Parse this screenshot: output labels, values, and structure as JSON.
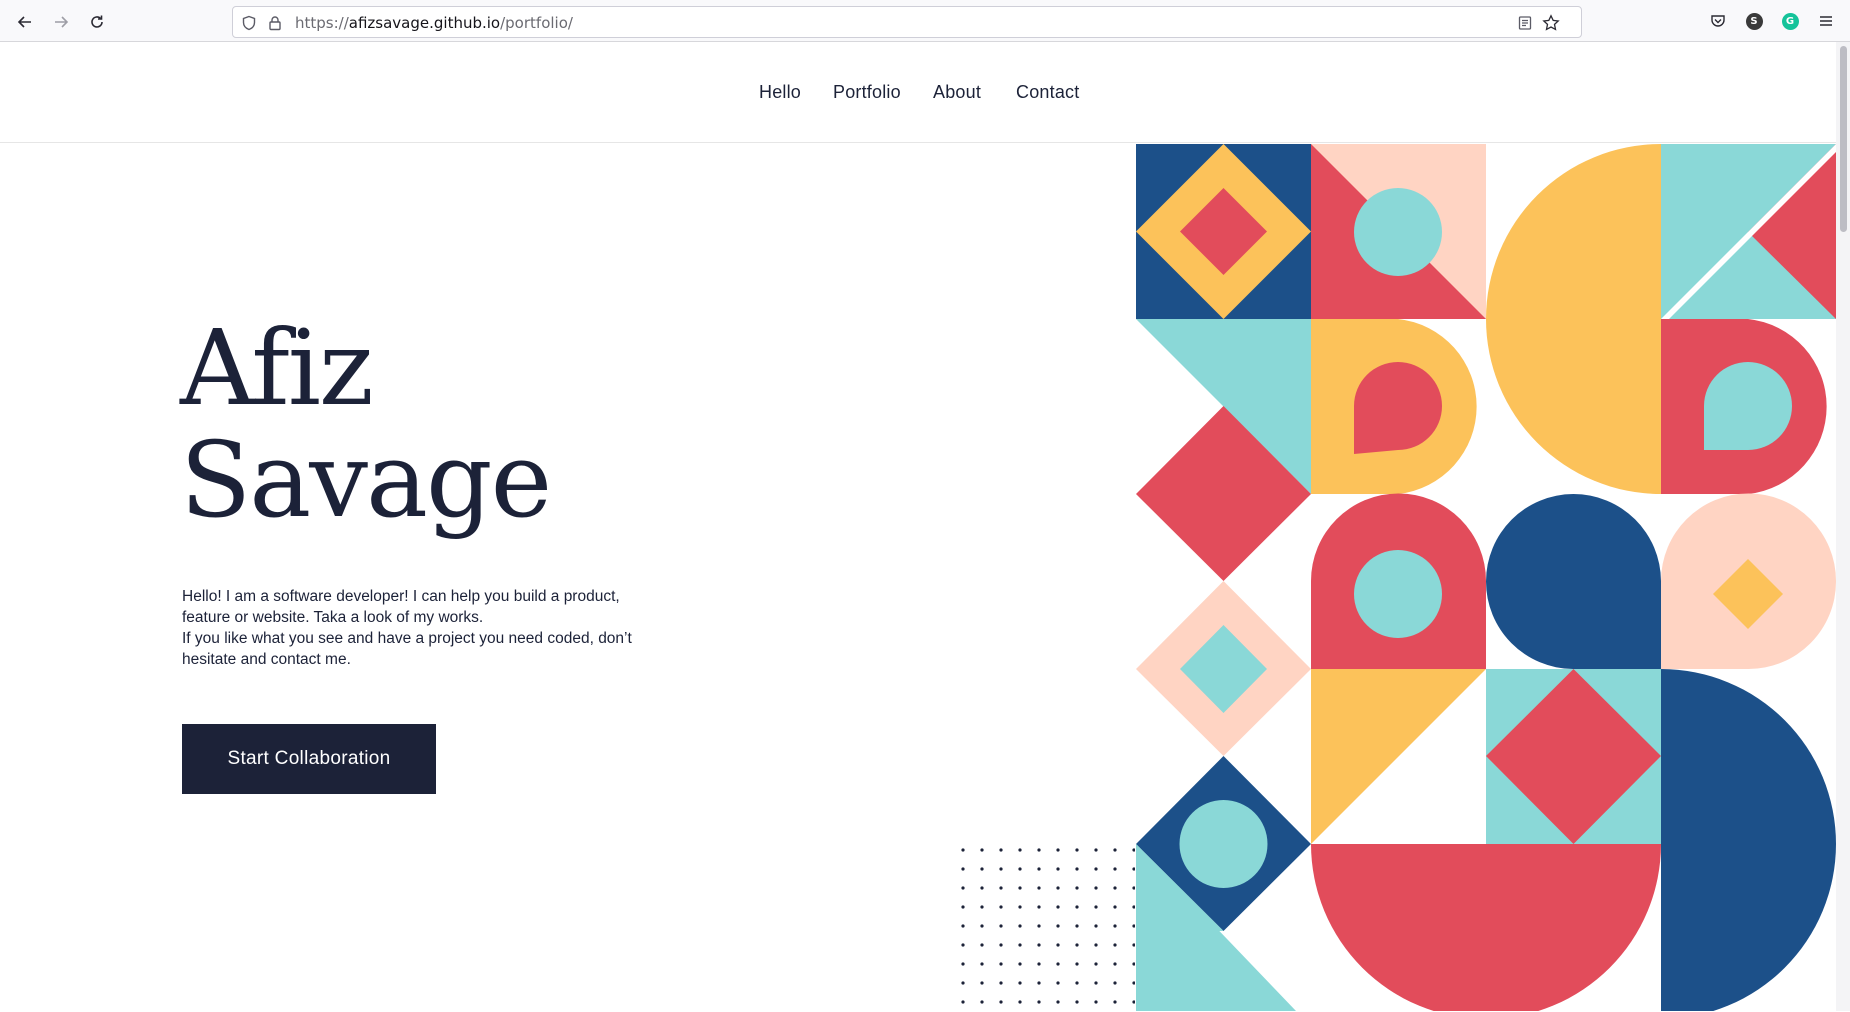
{
  "browser": {
    "url_prefix": "https://",
    "url_host": "afizsavage.github.io",
    "url_path": "/portfolio/",
    "icons": {
      "back": "arrow-left-icon",
      "forward": "arrow-right-icon",
      "reload": "reload-icon",
      "tracking_protection": "shield-icon",
      "lock": "lock-icon",
      "reader_view": "reader-view-icon",
      "bookmark": "star-icon",
      "pocket": "pocket-icon",
      "menu": "hamburger-menu-icon"
    },
    "extensions": [
      {
        "letter": "S",
        "color": "#3a3a3a"
      },
      {
        "letter": "G",
        "color": "#15c39a"
      }
    ]
  },
  "nav": {
    "items": [
      {
        "label": "Hello"
      },
      {
        "label": "Portfolio"
      },
      {
        "label": "About"
      },
      {
        "label": "Contact"
      }
    ]
  },
  "hero": {
    "title_line1": "Afiz",
    "title_line2": "Savage",
    "intro_line1": "Hello! I am a software developer! I can help you build a product, feature or website. Taka a look of my works.",
    "intro_line2": "If you like what you see and have a project you need coded, don’t hesitate and contact me.",
    "cta_label": "Start Collaboration"
  },
  "colors": {
    "navy": "#1c5089",
    "yellow": "#fcc25a",
    "red": "#e24c5b",
    "teal": "#8ad8d7",
    "peach": "#ffd4c3",
    "text_dark": "#1c2238"
  }
}
